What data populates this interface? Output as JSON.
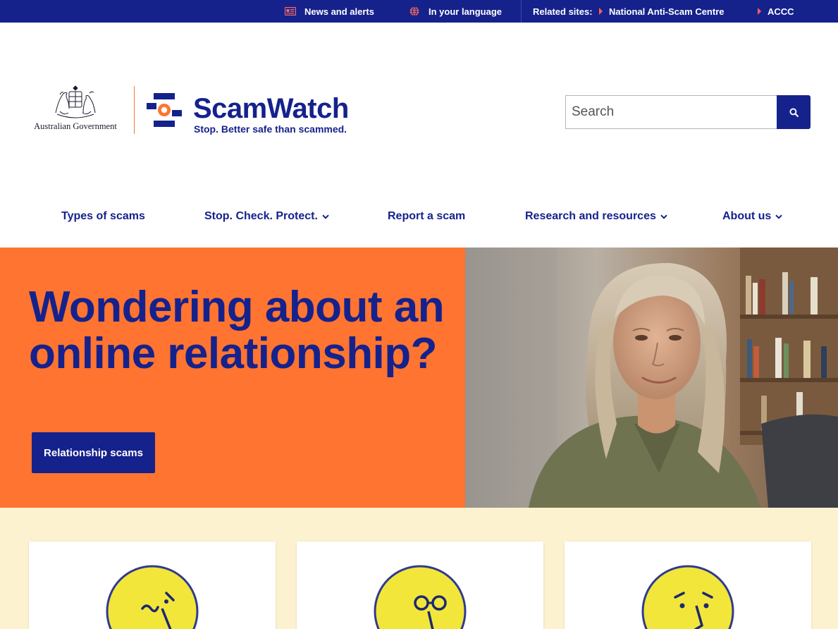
{
  "topbar": {
    "news_label": "News and alerts",
    "language_label": "In your language",
    "related_label": "Related sites:",
    "related_links": [
      "National Anti-Scam Centre",
      "ACCC"
    ],
    "icons": {
      "news": "newspaper-icon",
      "language": "globe-icon",
      "related": "triangle-right-icon"
    }
  },
  "header": {
    "gov_text": "Australian Government",
    "brand_name": "ScamWatch",
    "tagline": "Stop. Better safe than scammed."
  },
  "search": {
    "placeholder": "Search",
    "button_icon": "search-icon"
  },
  "nav": {
    "items": [
      {
        "label": "Types of scams",
        "dropdown": false
      },
      {
        "label": "Stop. Check. Protect.",
        "dropdown": true
      },
      {
        "label": "Report a scam",
        "dropdown": false
      },
      {
        "label": "Research and resources",
        "dropdown": true
      },
      {
        "label": "About us",
        "dropdown": true
      }
    ]
  },
  "hero": {
    "title": "Wondering about an online relationship?",
    "button_label": "Relationship scams"
  },
  "cards": [
    {
      "icon": "smirking-face-icon"
    },
    {
      "icon": "glasses-face-icon"
    },
    {
      "icon": "surprised-face-icon"
    }
  ],
  "colors": {
    "navy": "#15228c",
    "orange": "#ff7430",
    "cream": "#fdf2cf",
    "face_yellow": "#f3e63a"
  }
}
